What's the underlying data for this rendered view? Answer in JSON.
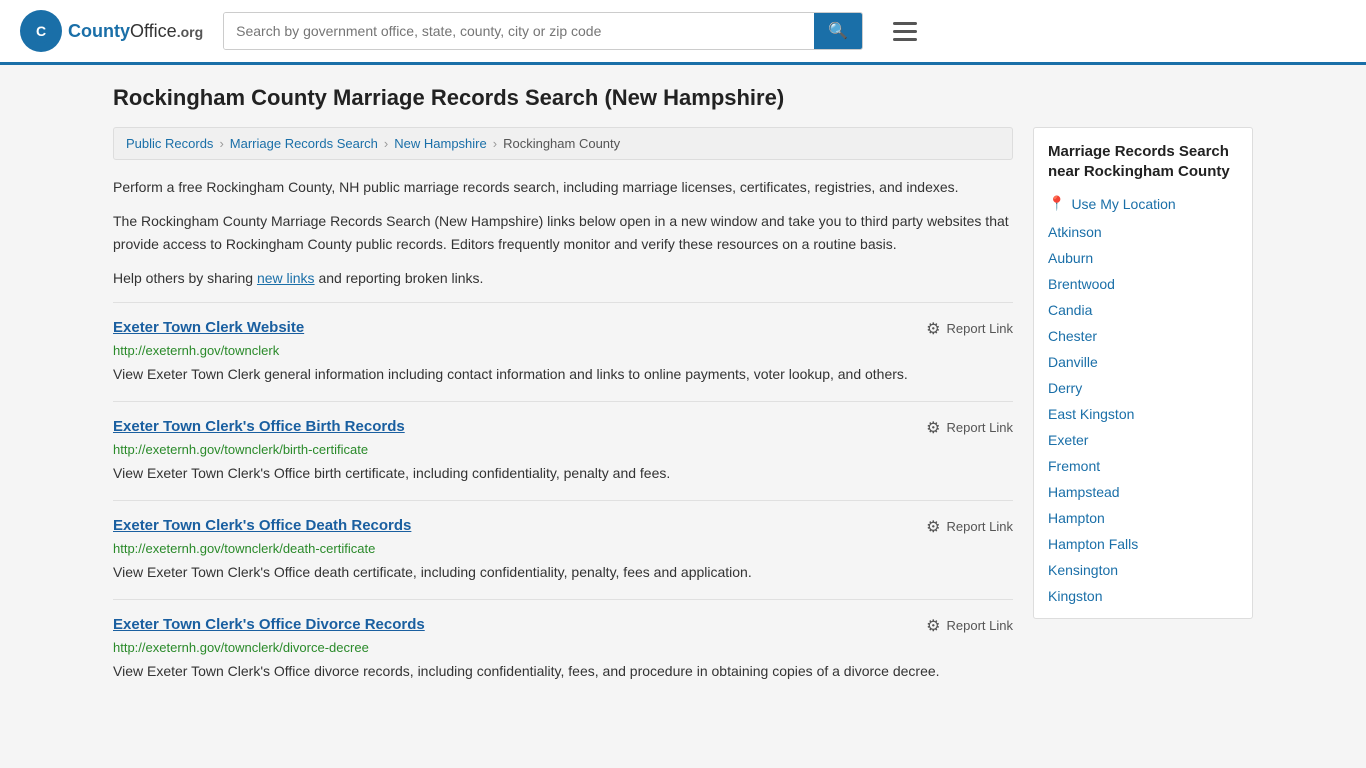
{
  "header": {
    "logo_text": "CountyOffice",
    "logo_org": ".org",
    "search_placeholder": "Search by government office, state, county, city or zip code",
    "search_icon": "🔍"
  },
  "page": {
    "title": "Rockingham County Marriage Records Search (New Hampshire)",
    "description1": "Perform a free Rockingham County, NH public marriage records search, including marriage licenses, certificates, registries, and indexes.",
    "description2": "The Rockingham County Marriage Records Search (New Hampshire) links below open in a new window and take you to third party websites that provide access to Rockingham County public records. Editors frequently monitor and verify these resources on a routine basis.",
    "description3_prefix": "Help others by sharing ",
    "description3_link": "new links",
    "description3_suffix": " and reporting broken links."
  },
  "breadcrumb": {
    "items": [
      {
        "label": "Public Records",
        "href": "#"
      },
      {
        "label": "Marriage Records Search",
        "href": "#"
      },
      {
        "label": "New Hampshire",
        "href": "#"
      },
      {
        "label": "Rockingham County",
        "href": "#"
      }
    ]
  },
  "results": [
    {
      "title": "Exeter Town Clerk Website",
      "url": "http://exeternh.gov/townclerk",
      "description": "View Exeter Town Clerk general information including contact information and links to online payments, voter lookup, and others.",
      "report_label": "Report Link"
    },
    {
      "title": "Exeter Town Clerk's Office Birth Records",
      "url": "http://exeternh.gov/townclerk/birth-certificate",
      "description": "View Exeter Town Clerk's Office birth certificate, including confidentiality, penalty and fees.",
      "report_label": "Report Link"
    },
    {
      "title": "Exeter Town Clerk's Office Death Records",
      "url": "http://exeternh.gov/townclerk/death-certificate",
      "description": "View Exeter Town Clerk's Office death certificate, including confidentiality, penalty, fees and application.",
      "report_label": "Report Link"
    },
    {
      "title": "Exeter Town Clerk's Office Divorce Records",
      "url": "http://exeternh.gov/townclerk/divorce-decree",
      "description": "View Exeter Town Clerk's Office divorce records, including confidentiality, fees, and procedure in obtaining copies of a divorce decree.",
      "report_label": "Report Link"
    }
  ],
  "sidebar": {
    "title": "Marriage Records Search near Rockingham County",
    "location_label": "Use My Location",
    "links": [
      "Atkinson",
      "Auburn",
      "Brentwood",
      "Candia",
      "Chester",
      "Danville",
      "Derry",
      "East Kingston",
      "Exeter",
      "Fremont",
      "Hampstead",
      "Hampton",
      "Hampton Falls",
      "Kensington",
      "Kingston"
    ]
  }
}
